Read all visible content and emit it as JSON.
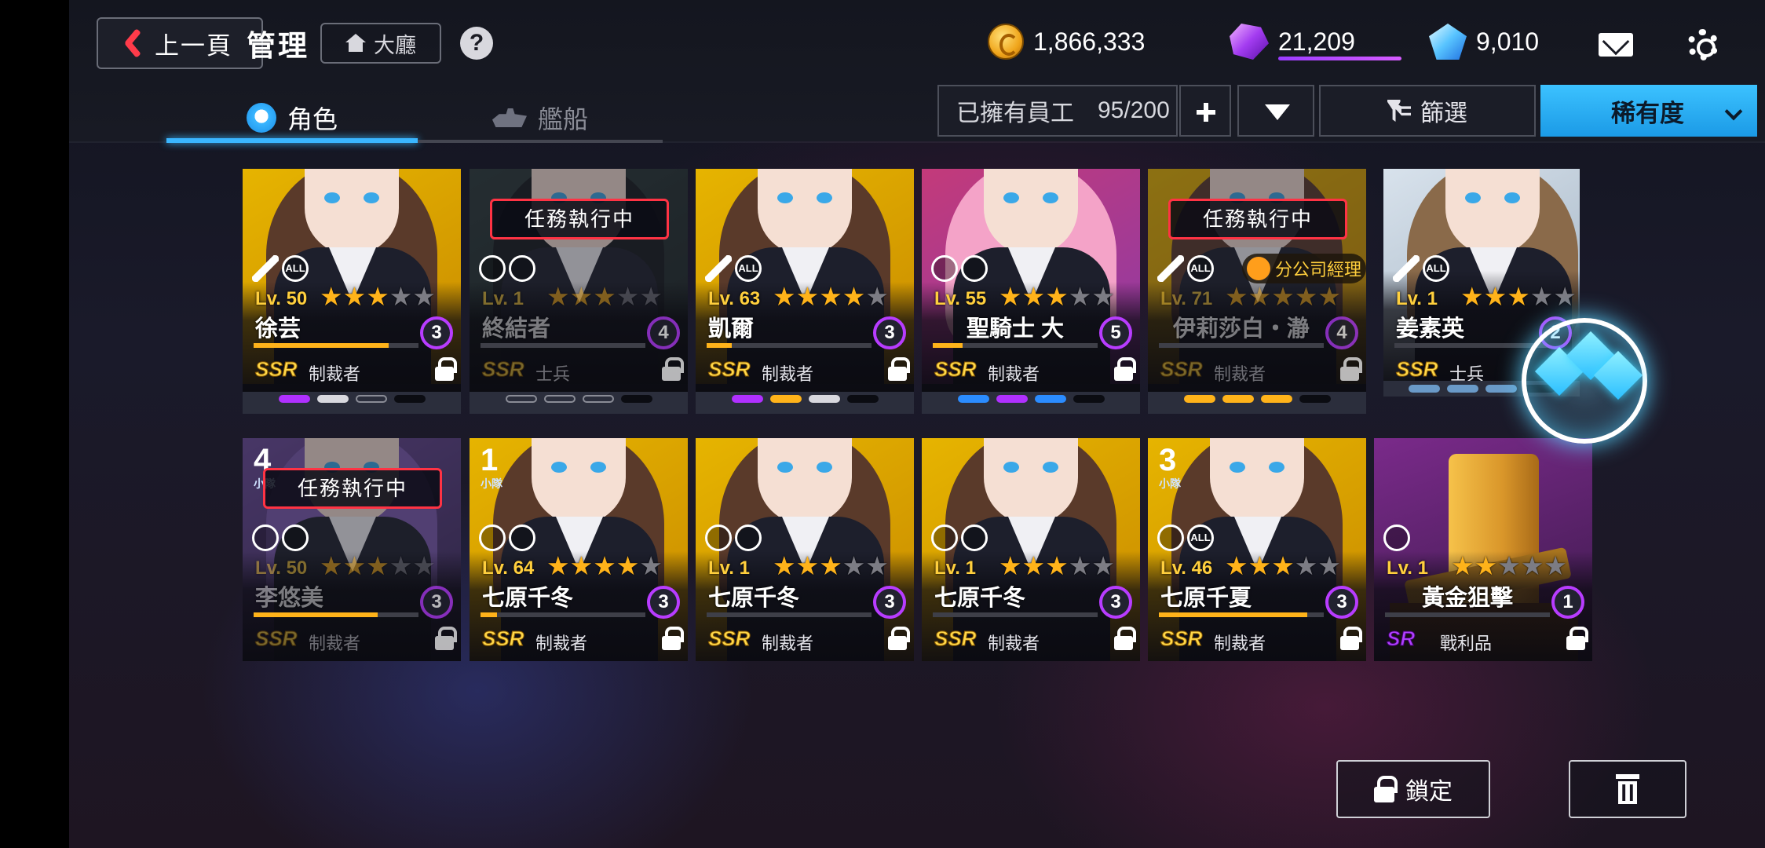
{
  "header": {
    "back_label": "上一頁",
    "title": "管理",
    "lobby_label": "大廳",
    "help_label": "?"
  },
  "currencies": {
    "gold": "1,866,333",
    "purple_gem": "21,209",
    "diamond": "9,010"
  },
  "tabs": [
    {
      "label": "角色",
      "active": true
    },
    {
      "label": "艦船",
      "active": false
    }
  ],
  "toolbar": {
    "owned_label": "已擁有員工",
    "owned_count": "95/200",
    "filter_label": "篩選",
    "sort_label": "稀有度"
  },
  "cards": [
    {
      "level": "Lv. 50",
      "stars": 3,
      "name": "徐芸",
      "star_badge": "3",
      "rarity": "SSR",
      "role": "制裁者",
      "progress": 0.82,
      "mission": "",
      "classes": [
        "gun",
        "ALL"
      ],
      "theme": "yellow"
    },
    {
      "level": "Lv. 1",
      "stars": 3,
      "name": "終結者",
      "star_badge": "4",
      "rarity": "SSR",
      "role": "士兵",
      "progress": 0.0,
      "mission": "任務執行中",
      "classes": [
        "sword",
        "target"
      ],
      "theme": "dark"
    },
    {
      "level": "Lv. 63",
      "stars": 4,
      "name": "凱爾",
      "star_badge": "3",
      "rarity": "SSR",
      "role": "制裁者",
      "progress": 0.15,
      "mission": "",
      "classes": [
        "gun",
        "ALL"
      ],
      "theme": "yellow"
    },
    {
      "level": "Lv. 55",
      "stars": 3,
      "name": "聖騎士 ⼤",
      "star_badge": "5",
      "rarity": "SSR",
      "role": "制裁者",
      "progress": 0.18,
      "mission": "",
      "classes": [
        "sword",
        "target"
      ],
      "theme": "pink"
    },
    {
      "level": "Lv. 71",
      "stars": 5,
      "name": "伊莉莎白・瀞",
      "star_badge": "4",
      "rarity": "SSR",
      "role": "制裁者",
      "progress": 0.0,
      "mission": "任務執行中",
      "manager": "分公司經理",
      "classes": [
        "gun",
        "ALL"
      ],
      "theme": "yellow"
    },
    {
      "level": "Lv. 1",
      "stars": 3,
      "name": "姜素英",
      "star_badge": "2",
      "rarity": "SSR",
      "role": "士兵",
      "progress": 0.0,
      "mission": "",
      "classes": [
        "gun",
        "ALL"
      ],
      "theme": "light"
    },
    {
      "level": "Lv. 50",
      "stars": 3,
      "name": "李悠美",
      "star_badge": "3",
      "rarity": "SSR",
      "role": "制裁者",
      "progress": 0.75,
      "mission": "任務執行中",
      "squad": "4",
      "classes": [
        "shield",
        "target"
      ],
      "theme": "purple"
    },
    {
      "level": "Lv. 64",
      "stars": 4,
      "name": "七原千冬",
      "star_badge": "3",
      "rarity": "SSR",
      "role": "制裁者",
      "progress": 0.1,
      "mission": "",
      "squad": "1",
      "classes": [
        "sword",
        "target"
      ],
      "theme": "yellow"
    },
    {
      "level": "Lv. 1",
      "stars": 3,
      "name": "七原千冬",
      "star_badge": "3",
      "rarity": "SSR",
      "role": "制裁者",
      "progress": 0.0,
      "mission": "",
      "classes": [
        "sword",
        "target"
      ],
      "theme": "yellow"
    },
    {
      "level": "Lv. 1",
      "stars": 3,
      "name": "七原千冬",
      "star_badge": "3",
      "rarity": "SSR",
      "role": "制裁者",
      "progress": 0.0,
      "mission": "",
      "classes": [
        "sword",
        "target"
      ],
      "theme": "yellow"
    },
    {
      "level": "Lv. 46",
      "stars": 3,
      "name": "七原千夏",
      "star_badge": "3",
      "rarity": "SSR",
      "role": "制裁者",
      "progress": 0.9,
      "mission": "",
      "squad": "3",
      "classes": [
        "heal",
        "ALL"
      ],
      "theme": "yellow"
    },
    {
      "level": "Lv. 1",
      "stars": 2,
      "name": "黃金狙擊",
      "star_badge": "1",
      "rarity": "SR",
      "role": "戰利品",
      "progress": 0.0,
      "mission": "",
      "classes": [
        "scope"
      ],
      "theme": "gold"
    }
  ],
  "squad_label": "小隊",
  "actions": {
    "lock_label": "鎖定",
    "delete_label": ""
  },
  "colors": {
    "accent": "#3ab6ff",
    "mission_border": "#ff3344",
    "star": "#ffb31a",
    "ssr": "#ffd84a",
    "sr": "#b040ff"
  }
}
